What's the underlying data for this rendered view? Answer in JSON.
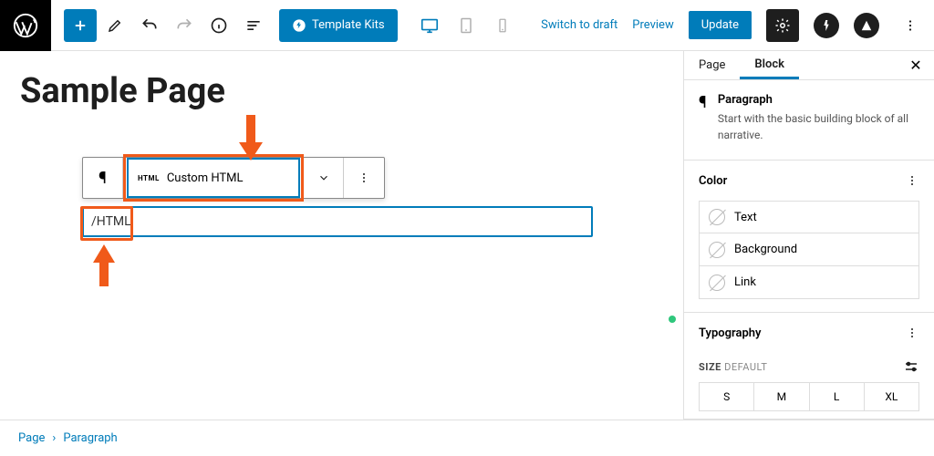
{
  "topbar": {
    "template_kits_label": "Template Kits",
    "draft_link": "Switch to draft",
    "preview_link": "Preview",
    "update_button": "Update"
  },
  "editor": {
    "page_title": "Sample Page",
    "suggestion_label": "Custom HTML",
    "suggestion_badge": "HTML",
    "slash_input_value": "/HTML"
  },
  "sidebar": {
    "tab_page": "Page",
    "tab_block": "Block",
    "block_name": "Paragraph",
    "block_description": "Start with the basic building block of all narrative.",
    "panel_color": "Color",
    "color_text": "Text",
    "color_background": "Background",
    "color_link": "Link",
    "panel_typography": "Typography",
    "size_label": "SIZE",
    "size_default": "DEFAULT",
    "size_s": "S",
    "size_m": "M",
    "size_l": "L",
    "size_xl": "XL"
  },
  "breadcrumb": {
    "root": "Page",
    "current": "Paragraph"
  }
}
